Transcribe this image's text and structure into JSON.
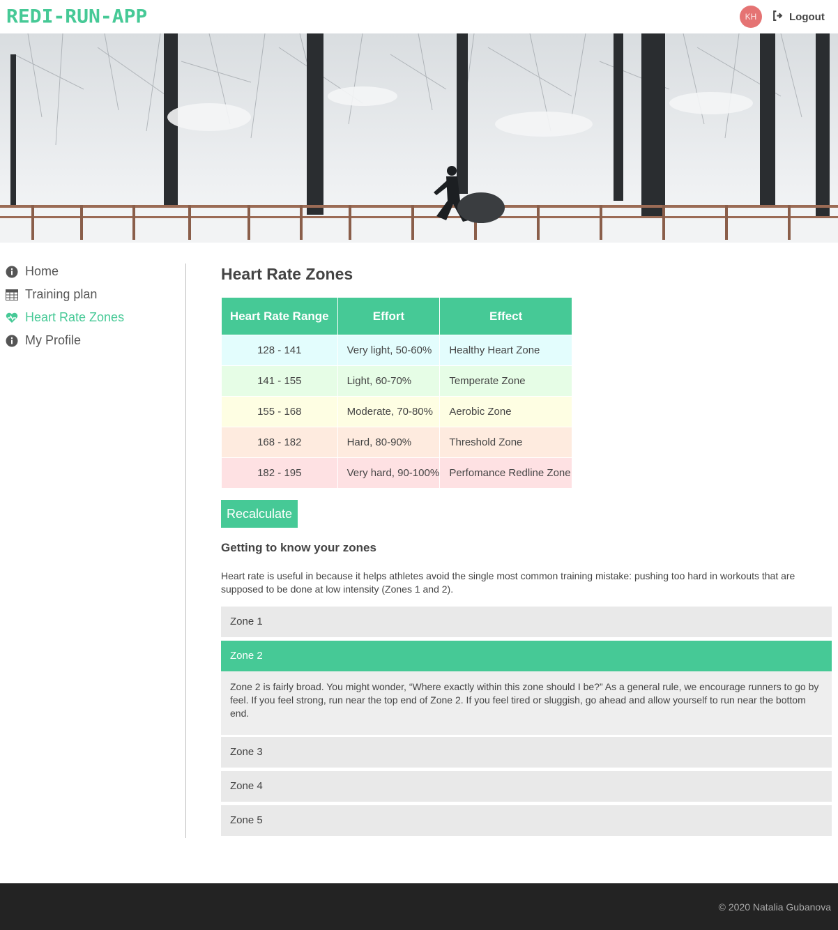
{
  "header": {
    "logo": "REDI-RUN-APP",
    "avatar_initials": "KH",
    "logout_label": "Logout",
    "brand_color": "#46c996",
    "avatar_color": "#e57373"
  },
  "hero": {
    "description_icon": "hero-image"
  },
  "sidebar": {
    "items": [
      {
        "label": "Home",
        "icon": "info-icon",
        "active": false
      },
      {
        "label": "Training plan",
        "icon": "calendar-icon",
        "active": false
      },
      {
        "label": "Heart Rate Zones",
        "icon": "heartbeat-icon",
        "active": true
      },
      {
        "label": "My Profile",
        "icon": "info-icon",
        "active": false
      }
    ]
  },
  "main": {
    "title": "Heart Rate Zones",
    "table": {
      "headers": [
        "Heart Rate Range",
        "Effort",
        "Effect"
      ],
      "rows": [
        {
          "range": "128 - 141",
          "effort": "Very light, 50-60%",
          "effect": "Healthy Heart Zone",
          "color": "#e3fdfd"
        },
        {
          "range": "141 - 155",
          "effort": "Light, 60-70%",
          "effect": "Temperate Zone",
          "color": "#e6fde6"
        },
        {
          "range": "155 - 168",
          "effort": "Moderate, 70-80%",
          "effect": "Aerobic Zone",
          "color": "#fefee3"
        },
        {
          "range": "168 - 182",
          "effort": "Hard, 80-90%",
          "effect": "Threshold Zone",
          "color": "#feebdf"
        },
        {
          "range": "182 - 195",
          "effort": "Very hard, 90-100%",
          "effect": "Perfomance Redline Zone",
          "color": "#fee1e3"
        }
      ]
    },
    "recalculate_label": "Recalculate",
    "subheading": "Getting to know your zones",
    "intro": "Heart rate is useful in because it helps athletes avoid the single most common training mistake: pushing too hard in workouts that are supposed to be done at low intensity (Zones 1 and 2).",
    "accordion": [
      {
        "label": "Zone 1",
        "open": false
      },
      {
        "label": "Zone 2",
        "open": true,
        "body": "Zone 2 is fairly broad. You might wonder, “Where exactly within this zone should I be?” As a general rule, we encourage runners to go by feel. If you feel strong, run near the top end of Zone 2. If you feel tired or sluggish, go ahead and allow yourself to run near the bottom end."
      },
      {
        "label": "Zone 3",
        "open": false
      },
      {
        "label": "Zone 4",
        "open": false
      },
      {
        "label": "Zone 5",
        "open": false
      }
    ]
  },
  "footer": {
    "copyright": "© 2020 Natalia Gubanova"
  }
}
